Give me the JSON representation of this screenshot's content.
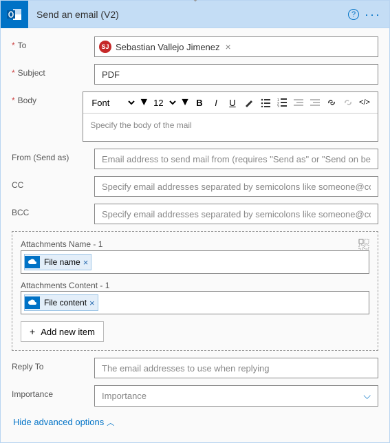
{
  "header": {
    "title": "Send an email (V2)"
  },
  "fields": {
    "to_label": "To",
    "to_chip_initials": "SJ",
    "to_chip_name": "Sebastian Vallejo Jimenez",
    "subject_label": "Subject",
    "subject_value": "PDF",
    "body_label": "Body",
    "body_placeholder": "Specify the body of the mail",
    "font_select": "Font",
    "size_select": "12",
    "from_label": "From (Send as)",
    "from_placeholder": "Email address to send mail from (requires \"Send as\" or \"Send on beh",
    "cc_label": "CC",
    "cc_placeholder": "Specify email addresses separated by semicolons like someone@con",
    "bcc_label": "BCC",
    "bcc_placeholder": "Specify email addresses separated by semicolons like someone@con"
  },
  "attachments": {
    "name_label": "Attachments Name - 1",
    "name_token": "File name",
    "content_label": "Attachments Content - 1",
    "content_token": "File content",
    "add_label": "Add new item"
  },
  "footer": {
    "replyto_label": "Reply To",
    "replyto_placeholder": "The email addresses to use when replying",
    "importance_label": "Importance",
    "importance_value": "Importance",
    "hide_link": "Hide advanced options"
  }
}
